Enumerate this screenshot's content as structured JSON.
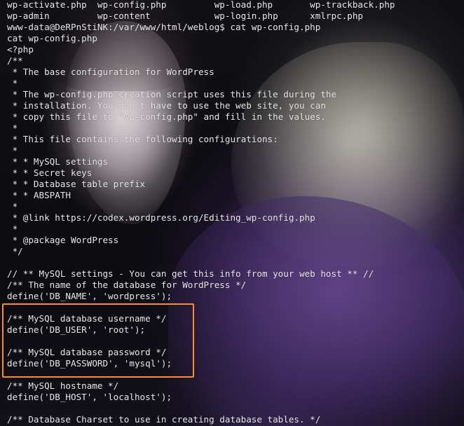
{
  "terminal": {
    "lines": [
      "wp-activate.php  wp-config.php         wp-load.php       wp-trackback.php",
      "wp-admin         wp-content            wp-login.php      xmlrpc.php",
      "www-data@DeRPnStiNK:/var/www/html/weblog$ cat wp-config.php",
      "cat wp-config.php",
      "<?php",
      "/**",
      " * The base configuration for WordPress",
      " *",
      " * The wp-config.php creation script uses this file during the",
      " * installation. You don't have to use the web site, you can",
      " * copy this file to \"wp-config.php\" and fill in the values.",
      " *",
      " * This file contains the following configurations:",
      " *",
      " * * MySQL settings",
      " * * Secret keys",
      " * * Database table prefix",
      " * * ABSPATH",
      " *",
      " * @link https://codex.wordpress.org/Editing_wp-config.php",
      " *",
      " * @package WordPress",
      " */",
      "",
      "// ** MySQL settings - You can get this info from your web host ** //",
      "/** The name of the database for WordPress */",
      "define('DB_NAME', 'wordpress');",
      "",
      "/** MySQL database username */",
      "define('DB_USER', 'root');",
      "",
      "/** MySQL database password */",
      "define('DB_PASSWORD', 'mysql');",
      "",
      "/** MySQL hostname */",
      "define('DB_HOST', 'localhost');",
      "",
      "/** Database Charset to use in creating database tables. */"
    ]
  },
  "colors": {
    "text": "#e9e9ec",
    "highlight_border": "#ff8c24"
  }
}
